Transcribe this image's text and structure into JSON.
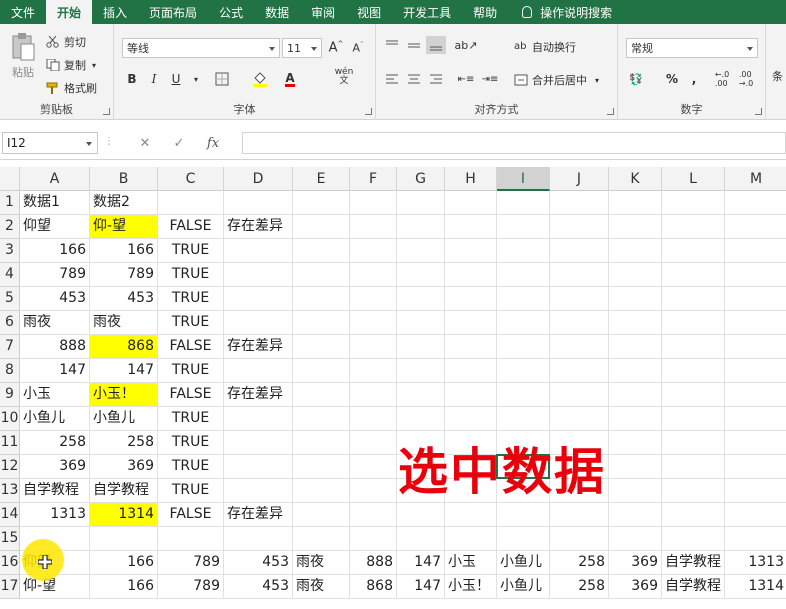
{
  "menu": {
    "items": [
      "文件",
      "开始",
      "插入",
      "页面布局",
      "公式",
      "数据",
      "审阅",
      "视图",
      "开发工具",
      "帮助"
    ],
    "active_index": 1,
    "search": "操作说明搜索"
  },
  "ribbon": {
    "clipboard": {
      "paste": "粘贴",
      "cut": "剪切",
      "copy": "复制",
      "format_painter": "格式刷",
      "label": "剪贴板"
    },
    "font": {
      "name": "等线",
      "size": "11",
      "label": "字体",
      "bold": "B",
      "italic": "I",
      "underline": "U",
      "wen": "wén"
    },
    "alignment": {
      "wrap": "自动换行",
      "merge": "合并后居中",
      "label": "对齐方式"
    },
    "number": {
      "format": "常规",
      "label": "数字",
      "percent": "%"
    },
    "cut_label_right": "条"
  },
  "formula_bar": {
    "name_box": "I12",
    "fx": "fx",
    "value": ""
  },
  "sheet": {
    "columns": [
      "A",
      "B",
      "C",
      "D",
      "E",
      "F",
      "G",
      "H",
      "I",
      "J",
      "K",
      "L",
      "M"
    ],
    "selected_column": "I",
    "rows": [
      [
        "数据1",
        "数据2",
        "",
        "",
        "",
        "",
        "",
        "",
        "",
        "",
        "",
        "",
        ""
      ],
      [
        "仰望",
        "仰-望",
        "FALSE",
        "存在差异",
        "",
        "",
        "",
        "",
        "",
        "",
        "",
        "",
        ""
      ],
      [
        "166",
        "166",
        "TRUE",
        "",
        "",
        "",
        "",
        "",
        "",
        "",
        "",
        "",
        ""
      ],
      [
        "789",
        "789",
        "TRUE",
        "",
        "",
        "",
        "",
        "",
        "",
        "",
        "",
        "",
        ""
      ],
      [
        "453",
        "453",
        "TRUE",
        "",
        "",
        "",
        "",
        "",
        "",
        "",
        "",
        "",
        ""
      ],
      [
        "雨夜",
        "雨夜",
        "TRUE",
        "",
        "",
        "",
        "",
        "",
        "",
        "",
        "",
        "",
        ""
      ],
      [
        "888",
        "868",
        "FALSE",
        "存在差异",
        "",
        "",
        "",
        "",
        "",
        "",
        "",
        "",
        ""
      ],
      [
        "147",
        "147",
        "TRUE",
        "",
        "",
        "",
        "",
        "",
        "",
        "",
        "",
        "",
        ""
      ],
      [
        "小玉",
        "小玉！",
        "FALSE",
        "存在差异",
        "",
        "",
        "",
        "",
        "",
        "",
        "",
        "",
        ""
      ],
      [
        "小鱼儿",
        "小鱼儿",
        "TRUE",
        "",
        "",
        "",
        "",
        "",
        "",
        "",
        "",
        "",
        ""
      ],
      [
        "258",
        "258",
        "TRUE",
        "",
        "",
        "",
        "",
        "",
        "",
        "",
        "",
        "",
        ""
      ],
      [
        "369",
        "369",
        "TRUE",
        "",
        "",
        "",
        "",
        "",
        "",
        "",
        "",
        "",
        ""
      ],
      [
        "自学教程",
        "自学教程",
        "TRUE",
        "",
        "",
        "",
        "",
        "",
        "",
        "",
        "",
        "",
        ""
      ],
      [
        "1313",
        "1314",
        "FALSE",
        "存在差异",
        "",
        "",
        "",
        "",
        "",
        "",
        "",
        "",
        ""
      ],
      [
        "",
        "",
        "",
        "",
        "",
        "",
        "",
        "",
        "",
        "",
        "",
        "",
        ""
      ],
      [
        "仰望",
        "166",
        "789",
        "453",
        "雨夜",
        "888",
        "147",
        "小玉",
        "小鱼儿",
        "258",
        "369",
        "自学教程",
        "1313"
      ],
      [
        "仰-望",
        "166",
        "789",
        "453",
        "雨夜",
        "868",
        "147",
        "小玉！",
        "小鱼儿",
        "258",
        "369",
        "自学教程",
        "1314"
      ]
    ],
    "highlighted": [
      "B2",
      "B7",
      "B9",
      "B14"
    ],
    "active_cell": "I12"
  },
  "overlay_caption": "选中数据",
  "colors": {
    "accent": "#217346",
    "highlight": "#ffff00",
    "caption": "#e8000b"
  }
}
